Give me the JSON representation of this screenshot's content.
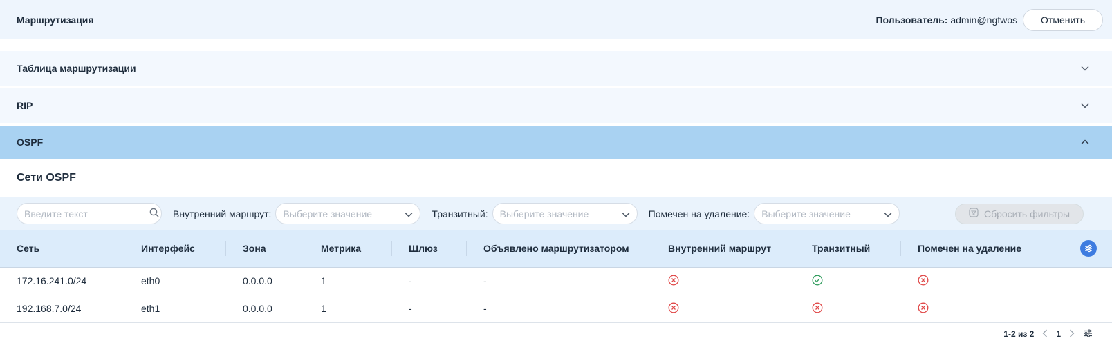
{
  "header": {
    "title": "Маршрутизация",
    "user_label": "Пользователь:",
    "user_name": "admin@ngfwos",
    "cancel_label": "Отменить"
  },
  "accordions": [
    {
      "label": "Таблица маршрутизации",
      "open": false
    },
    {
      "label": "RIP",
      "open": false
    },
    {
      "label": "OSPF",
      "open": true
    }
  ],
  "ospf": {
    "section_title": "Сети OSPF",
    "search_placeholder": "Введите текст",
    "filters": [
      {
        "label": "Внутренний маршрут",
        "placeholder": "Выберите значение"
      },
      {
        "label": "Транзитный",
        "placeholder": "Выберите значение"
      },
      {
        "label": "Помечен на удаление",
        "placeholder": "Выберите значение"
      }
    ],
    "reset_label": "Сбросить фильтры",
    "columns": [
      "Сеть",
      "Интерфейс",
      "Зона",
      "Метрика",
      "Шлюз",
      "Объявлено маршрутизатором",
      "Внутренний маршрут",
      "Транзитный",
      "Помечен на удаление"
    ],
    "rows": [
      {
        "network": "172.16.241.0/24",
        "interface": "eth0",
        "zone": "0.0.0.0",
        "metric": "1",
        "gateway": "-",
        "announced_by": "-",
        "internal": false,
        "transit": true,
        "marked_delete": false
      },
      {
        "network": "192.168.7.0/24",
        "interface": "eth1",
        "zone": "0.0.0.0",
        "metric": "1",
        "gateway": "-",
        "announced_by": "-",
        "internal": false,
        "transit": false,
        "marked_delete": false
      }
    ],
    "pagination": {
      "range": "1-2 из 2",
      "page": "1"
    }
  },
  "colors": {
    "accent": "#3e7ce0",
    "open_accordion": "#a9d2f2",
    "yes": "#2e9b5b",
    "no": "#e04848"
  }
}
